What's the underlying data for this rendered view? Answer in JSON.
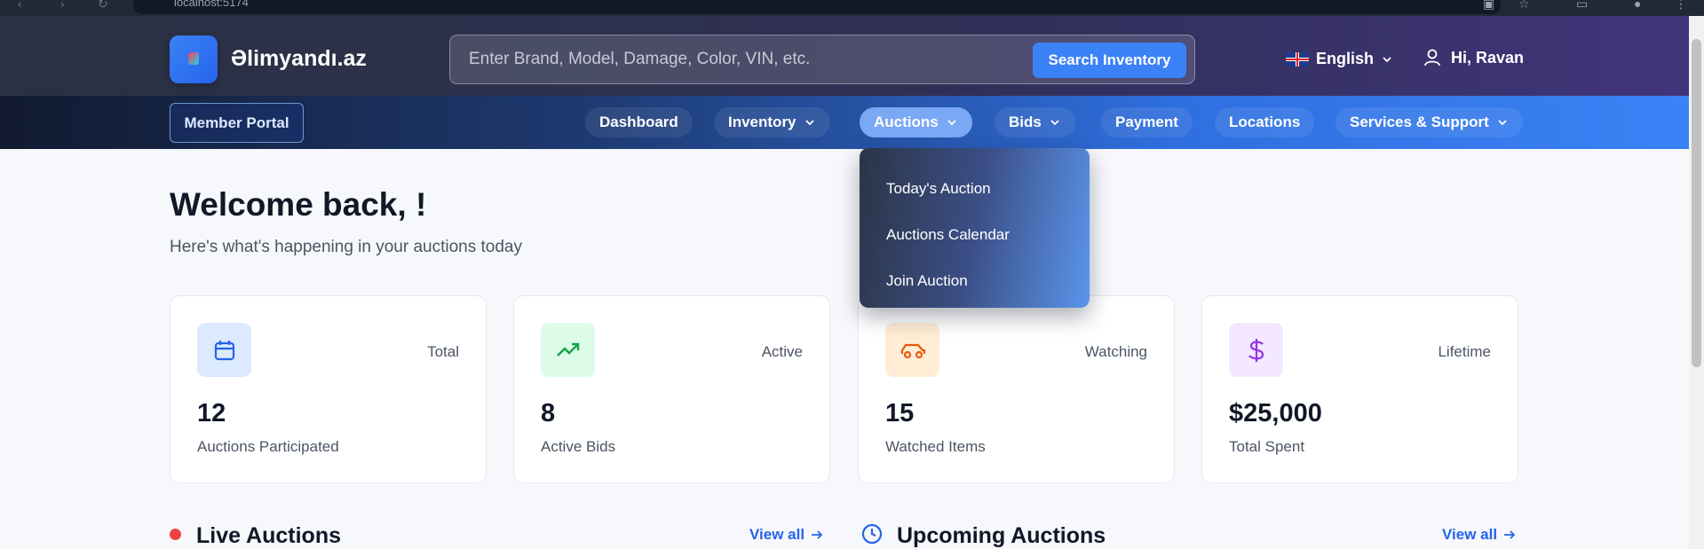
{
  "browser": {
    "url": "localhost:5174"
  },
  "header": {
    "brand": "Əlimyandı.az",
    "search": {
      "placeholder": "Enter Brand, Model, Damage, Color, VIN, etc.",
      "button_label": "Search Inventory"
    },
    "language": "English",
    "greeting": "Hi, Ravan"
  },
  "nav": {
    "portal_label": "Member Portal",
    "items": [
      {
        "label": "Dashboard"
      },
      {
        "label": "Inventory"
      },
      {
        "label": "Auctions"
      },
      {
        "label": "Bids"
      },
      {
        "label": "Payment"
      },
      {
        "label": "Locations"
      },
      {
        "label": "Services & Support"
      }
    ],
    "auctions_menu": [
      {
        "label": "Today's Auction"
      },
      {
        "label": "Auctions Calendar"
      },
      {
        "label": "Join Auction"
      }
    ]
  },
  "main": {
    "welcome": "Welcome back, !",
    "subtitle": "Here's what's happening in your auctions today",
    "stats": [
      {
        "tag": "Total",
        "value": "12",
        "label": "Auctions Participated",
        "icon": "calendar-icon",
        "color": "#2563eb",
        "bg": "#dbeafe"
      },
      {
        "tag": "Active",
        "value": "8",
        "label": "Active Bids",
        "icon": "trending-up-icon",
        "color": "#16a34a",
        "bg": "#dcfce7"
      },
      {
        "tag": "Watching",
        "value": "15",
        "label": "Watched Items",
        "icon": "car-icon",
        "color": "#ea580c",
        "bg": "#ffedd5"
      },
      {
        "tag": "Lifetime",
        "value": "$25,000",
        "label": "Total Spent",
        "icon": "dollar-icon",
        "color": "#9333ea",
        "bg": "#f3e8ff"
      }
    ],
    "sections": {
      "live_title": "Live Auctions",
      "upcoming_title": "Upcoming Auctions",
      "view_all": "View all"
    }
  }
}
